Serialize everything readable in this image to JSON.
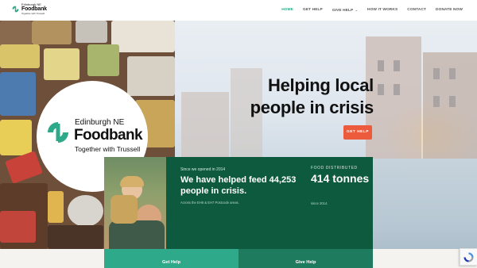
{
  "header": {
    "logo": {
      "line1": "Edinburgh NE",
      "line2": "Foodbank",
      "line3": "Together with Trussell",
      "brand_color": "#2ea98a"
    },
    "nav": [
      {
        "label": "HOME",
        "active": true
      },
      {
        "label": "GET HELP",
        "active": false
      },
      {
        "label": "GIVE HELP",
        "active": false,
        "has_dropdown": true
      },
      {
        "label": "HOW IT WORKS",
        "active": false
      },
      {
        "label": "CONTACT",
        "active": false
      },
      {
        "label": "DONATE NOW",
        "active": false
      }
    ]
  },
  "hero": {
    "headline": "Helping local people in crisis",
    "cta_label": "GET HELP",
    "cta_color": "#ec5b3b",
    "badge": {
      "line1": "Edinburgh NE",
      "line2": "Foodbank",
      "line3": "Together with Trussell"
    }
  },
  "stats": {
    "since_text": "Since we opened in 2014",
    "main_text": "We have helped feed 44,253 people in crisis.",
    "area_text": "Across the EH6 & EH7 Postcode areas.",
    "food_label": "FOOD DISTRIBUTED",
    "food_value": "414 tonnes",
    "food_since": "since 2014.",
    "panel_color": "#0e5a3f"
  },
  "tiles": [
    {
      "label": "Get Help",
      "color": "#2ea98a"
    },
    {
      "label": "Give Help",
      "color": "#1f7b5e"
    }
  ]
}
